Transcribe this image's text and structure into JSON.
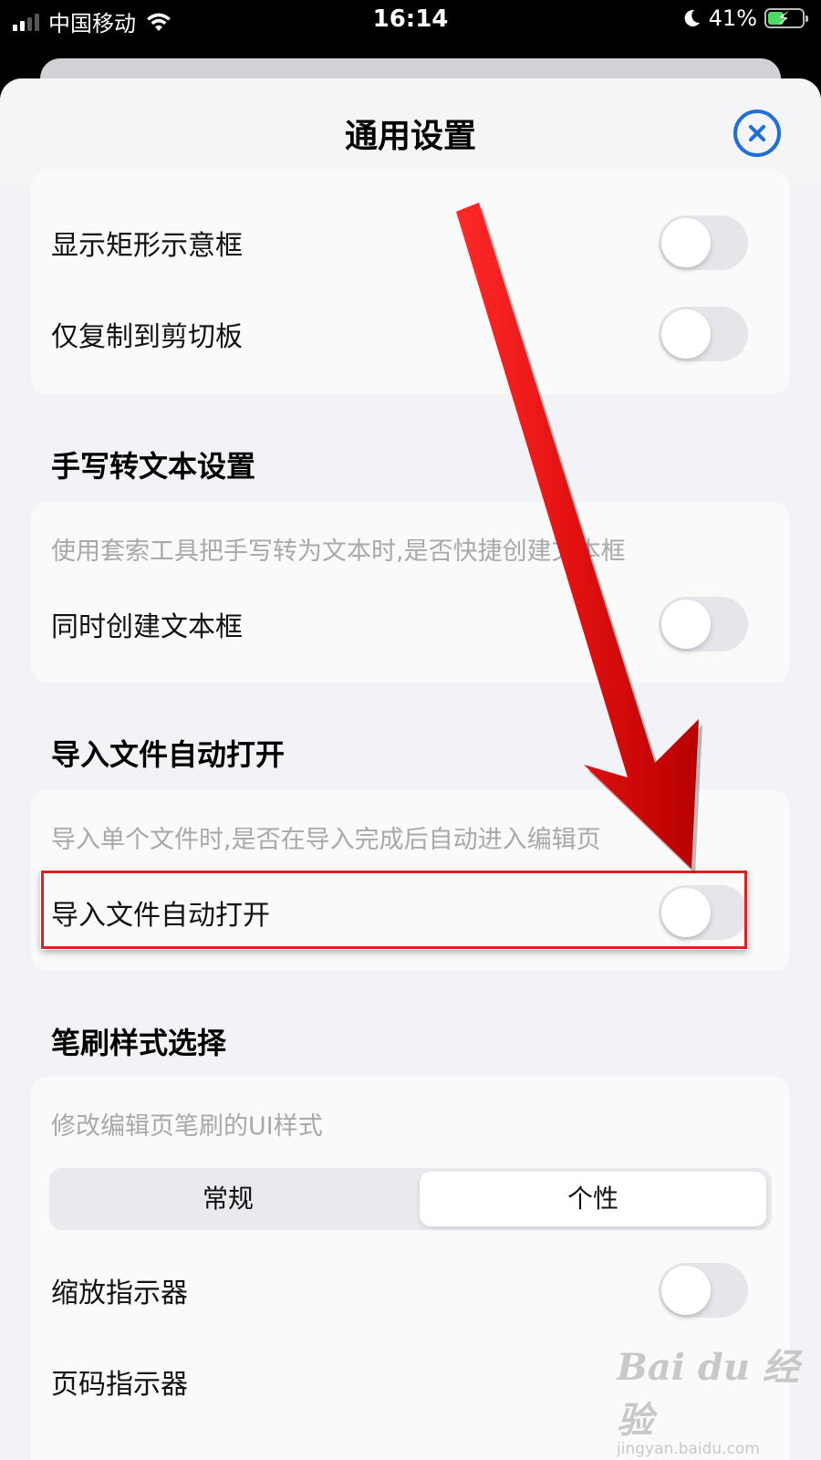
{
  "status_bar": {
    "carrier": "中国移动",
    "time": "16:14",
    "battery_percent": "41%",
    "battery_level": 0.41,
    "icons": [
      "signal-icon",
      "wifi-icon",
      "moon-icon",
      "battery-charging-icon"
    ]
  },
  "nav": {
    "title": "通用设置",
    "close_icon": "close-circle-icon",
    "accent": "#1e6fd9"
  },
  "group1": {
    "rows": [
      {
        "label": "显示矩形示意框",
        "on": false
      },
      {
        "label": "仅复制到剪切板",
        "on": false
      }
    ]
  },
  "section_handwriting": {
    "title": "手写转文本设置",
    "description": "使用套索工具把手写转为文本时,是否快捷创建文本框",
    "row": {
      "label": "同时创建文本框",
      "on": false
    }
  },
  "section_import": {
    "title": "导入文件自动打开",
    "description": "导入单个文件时,是否在导入完成后自动进入编辑页",
    "row": {
      "label": "导入文件自动打开",
      "on": false
    }
  },
  "section_brush": {
    "title": "笔刷样式选择",
    "description": "修改编辑页笔刷的UI样式",
    "segments": [
      "常规",
      "个性"
    ],
    "selected_segment": "个性",
    "rows": [
      {
        "label": "缩放指示器",
        "on": false
      },
      {
        "label": "页码指示器",
        "on": false
      }
    ]
  },
  "annotation": {
    "highlight_color": "#e02020",
    "arrow_color": "#e11010"
  },
  "watermark": {
    "logo": "Bai du 经验",
    "site": "jingyan.baidu.com"
  }
}
